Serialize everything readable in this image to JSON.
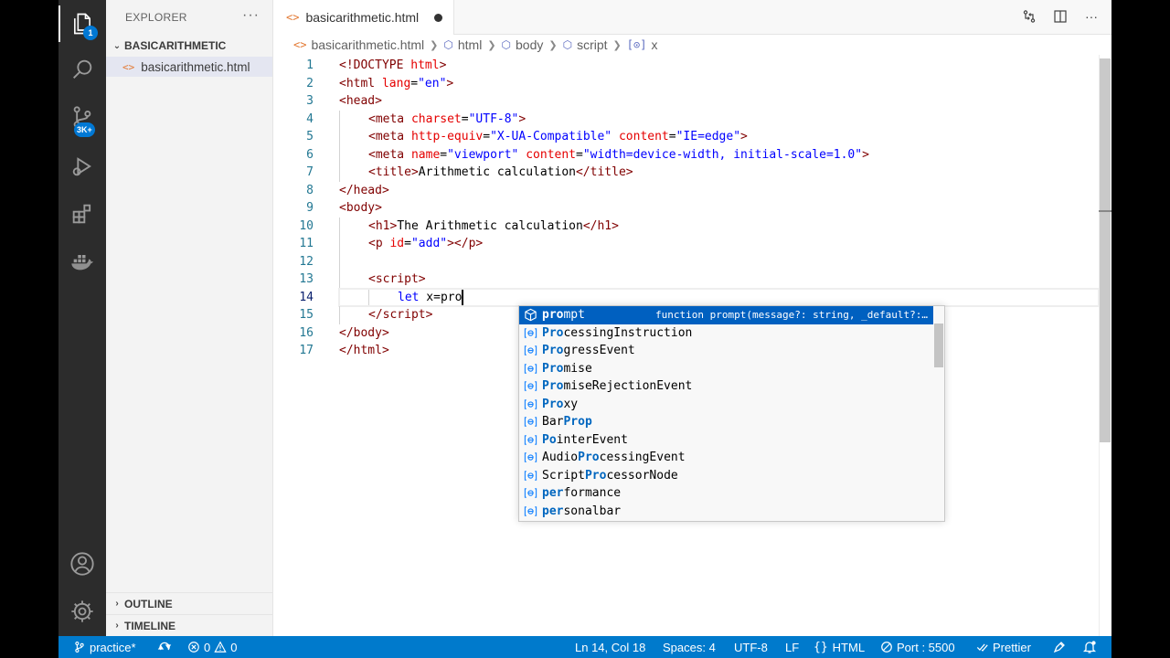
{
  "activity_bar": {
    "explorer_badge": "1",
    "source_control_badge": "3K+"
  },
  "sidebar": {
    "title": "EXPLORER",
    "more": "···",
    "folder": "BASICARITHMETIC",
    "file": "basicarithmetic.html",
    "sections": [
      "OUTLINE",
      "TIMELINE"
    ]
  },
  "tab": {
    "label": "basicarithmetic.html"
  },
  "breadcrumb": [
    "basicarithmetic.html",
    "html",
    "body",
    "script",
    "x"
  ],
  "editor": {
    "line_numbers": [
      "1",
      "2",
      "3",
      "4",
      "5",
      "6",
      "7",
      "8",
      "9",
      "10",
      "11",
      "12",
      "13",
      "14",
      "15",
      "16",
      "17"
    ],
    "current_line": "14"
  },
  "suggest": {
    "items": [
      {
        "pre": "",
        "match": "pro",
        "post": "mpt",
        "detail": "function prompt(message?: string, _default?:…",
        "icon": "cube-icon"
      },
      {
        "pre": "",
        "match": "Pro",
        "post": "cessingInstruction",
        "icon": "variable-icon"
      },
      {
        "pre": "",
        "match": "Pro",
        "post": "gressEvent",
        "icon": "variable-icon"
      },
      {
        "pre": "",
        "match": "Pro",
        "post": "mise",
        "icon": "variable-icon"
      },
      {
        "pre": "",
        "match": "Pro",
        "post": "miseRejectionEvent",
        "icon": "variable-icon"
      },
      {
        "pre": "",
        "match": "Pro",
        "post": "xy",
        "icon": "variable-icon"
      },
      {
        "pre": "Bar",
        "match": "Prop",
        "post": "",
        "icon": "variable-icon"
      },
      {
        "pre": "",
        "match": "Po",
        "post": "interEvent",
        "icon": "variable-icon"
      },
      {
        "pre": "Audio",
        "match": "Pro",
        "post": "cessingEvent",
        "icon": "variable-icon"
      },
      {
        "pre": "Script",
        "match": "Pro",
        "post": "cessorNode",
        "icon": "variable-icon"
      },
      {
        "pre": "",
        "match": "per",
        "post": "formance",
        "icon": "variable-icon"
      },
      {
        "pre": "",
        "match": "per",
        "post": "sonalbar",
        "icon": "variable-icon"
      }
    ]
  },
  "status_bar": {
    "branch": "practice*",
    "errors": "0",
    "warnings": "0",
    "position": "Ln 14, Col 18",
    "spaces": "Spaces: 4",
    "encoding": "UTF-8",
    "eol": "LF",
    "language": "HTML",
    "port": "Port : 5500",
    "formatter": "Prettier"
  }
}
